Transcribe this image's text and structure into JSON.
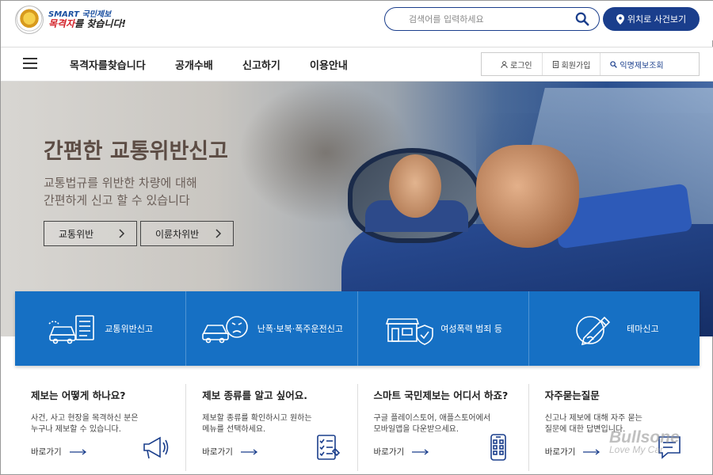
{
  "header": {
    "logo_line1": "SMART 국민제보",
    "logo_line2_highlight": "목격자",
    "logo_line2_rest": "를 찾습니다!",
    "search_placeholder": "검색어를 입력하세요",
    "location_button": "위치로 사건보기"
  },
  "nav": {
    "items": [
      "목격자를찾습니다",
      "공개수배",
      "신고하기",
      "이용안내"
    ],
    "util": [
      "로그인",
      "회원가입",
      "익명제보조회"
    ]
  },
  "hero": {
    "title": "간편한 교통위반신고",
    "subtitle_line1": "교통법규를 위반한 차량에 대해",
    "subtitle_line2": "간편하게 신고 할 수 있습니다",
    "buttons": [
      "교통위반",
      "이륜차위반"
    ]
  },
  "categories": [
    {
      "label": "교통위반신고",
      "icon": "traffic-report-icon"
    },
    {
      "label": "난폭·보복·폭주운전신고",
      "icon": "angry-car-icon"
    },
    {
      "label": "여성폭력 범죄 등",
      "icon": "shop-shield-icon"
    },
    {
      "label": "테마신고",
      "icon": "theme-pen-icon"
    }
  ],
  "info": [
    {
      "title": "제보는 어떻게 하나요?",
      "desc_line1": "사건, 사고 현장을 목격하신 분은",
      "desc_line2": "누구나 제보할 수 있습니다.",
      "link": "바로가기",
      "icon": "megaphone-icon"
    },
    {
      "title": "제보 종류를 알고 싶어요.",
      "desc_line1": "제보할 종류를 확인하시고 원하는",
      "desc_line2": "메뉴를 선택하세요.",
      "link": "바로가기",
      "icon": "checklist-icon"
    },
    {
      "title": "스마트 국민제보는 어디서 하죠?",
      "desc_line1": "구글 플레이스토어, 애플스토어에서",
      "desc_line2": "모바일앱을 다운받으세요.",
      "link": "바로가기",
      "icon": "smartphone-icon"
    },
    {
      "title": "자주묻는질문",
      "desc_line1": "신고나 제보에 대해 자주 묻는",
      "desc_line2": "질문에 대한 답변입니다.",
      "link": "바로가기",
      "icon": "chat-icon"
    }
  ],
  "watermark": {
    "line1": "Bullsone",
    "line2": "Love My Car"
  },
  "colors": {
    "primary": "#1a3e8c",
    "category_bg": "#1670c4"
  }
}
